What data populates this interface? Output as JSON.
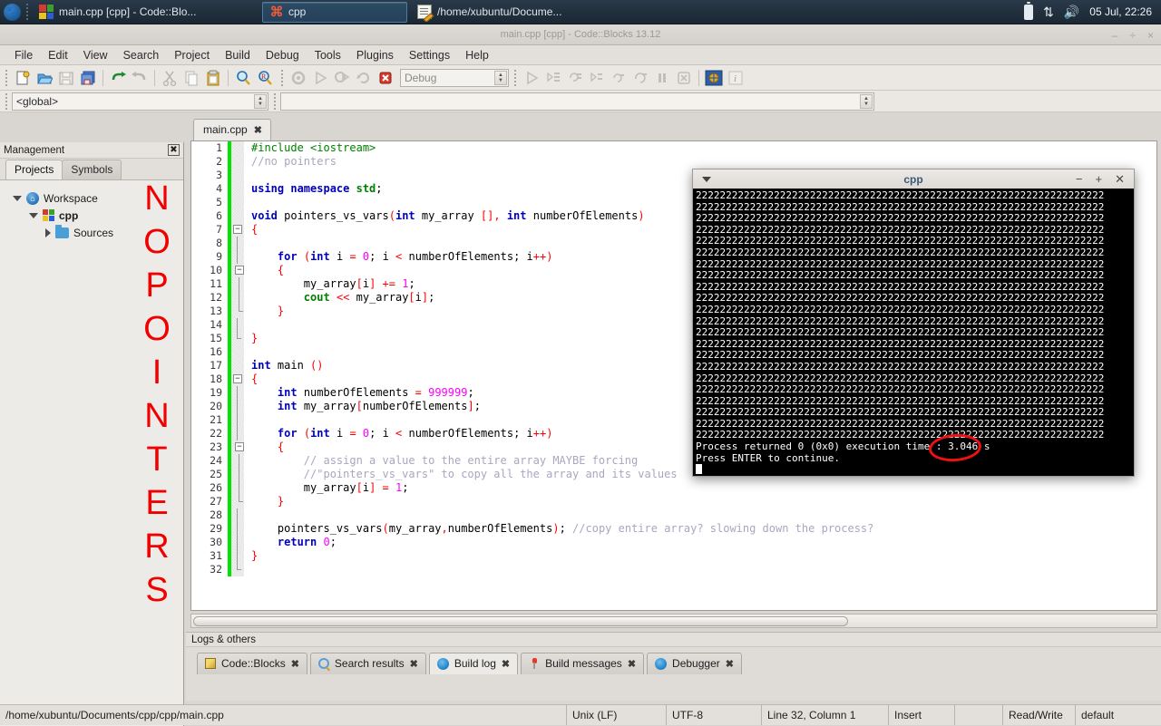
{
  "taskbar": {
    "menu_icon": "xfce-mouse-icon",
    "tasks": [
      {
        "label": "main.cpp [cpp] - Code::Blo...",
        "icon": "codeblocks-icon",
        "active": false
      },
      {
        "label": "cpp",
        "icon": "terminal-icon",
        "active": true
      },
      {
        "label": "/home/xubuntu/Docume...",
        "icon": "text-editor-icon",
        "active": false
      }
    ],
    "tray": {
      "battery": "battery-icon",
      "network": "network-updown-icon",
      "volume": "volume-icon"
    },
    "clock": "05 Jul, 22:26"
  },
  "window": {
    "title": "main.cpp [cpp] - Code::Blocks 13.12",
    "minimize": "–",
    "maximize": "÷",
    "close": "×"
  },
  "menubar": [
    "File",
    "Edit",
    "View",
    "Search",
    "Project",
    "Build",
    "Debug",
    "Tools",
    "Plugins",
    "Settings",
    "Help"
  ],
  "toolbar": {
    "debug_target": "Debug",
    "scope_combo": "<global>",
    "function_combo": ""
  },
  "management": {
    "header": "Management",
    "close_icon": "close-panel-icon",
    "tabs": [
      {
        "label": "Projects",
        "active": true
      },
      {
        "label": "Symbols",
        "active": false
      }
    ],
    "tree": [
      {
        "label": "Workspace",
        "icon": "workspace-icon",
        "expander": "down",
        "indent": 0
      },
      {
        "label": "cpp",
        "icon": "project-icon",
        "expander": "down",
        "indent": 1
      },
      {
        "label": "Sources",
        "icon": "folder-icon",
        "expander": "right",
        "indent": 2
      }
    ]
  },
  "overlay": {
    "text": "NO POINTERS",
    "letters": [
      "N",
      "O",
      "P",
      "O",
      "I",
      "N",
      "T",
      "E",
      "R",
      "S"
    ],
    "color": "#f20000"
  },
  "editor": {
    "tabs": [
      {
        "label": "main.cpp",
        "close": "✖",
        "active": true
      }
    ],
    "first_line": 1,
    "last_line": 32,
    "lines": [
      {
        "n": 1,
        "fold": "none",
        "html": "<span class='pre'>#include &lt;iostream&gt;</span>",
        "text": "#include <iostream>"
      },
      {
        "n": 2,
        "fold": "none",
        "html": "<span class='cmt'>//no pointers</span>",
        "text": "//no pointers"
      },
      {
        "n": 3,
        "fold": "none",
        "html": "",
        "text": ""
      },
      {
        "n": 4,
        "fold": "none",
        "html": "<span class='kw'>using namespace</span> <span class='gn'>std</span>;",
        "text": "using namespace std;"
      },
      {
        "n": 5,
        "fold": "none",
        "html": "",
        "text": ""
      },
      {
        "n": 6,
        "fold": "none",
        "html": "<span class='kw'>void</span> pointers_vs_vars<span class='op'>(</span><span class='kw'>int</span> my_array <span class='op'>[]</span><span class='op'>,</span> <span class='kw'>int</span> numberOfElements<span class='op'>)</span>",
        "text": "void pointers_vs_vars(int my_array [], int numberOfElements)"
      },
      {
        "n": 7,
        "fold": "box",
        "html": "<span class='op'>{</span>",
        "text": "{"
      },
      {
        "n": 8,
        "fold": "line",
        "html": "",
        "text": ""
      },
      {
        "n": 9,
        "fold": "line",
        "html": "    <span class='kw'>for</span> <span class='op'>(</span><span class='kw'>int</span> i <span class='op'>=</span> <span class='num'>0</span>; i <span class='op'>&lt;</span> numberOfElements; i<span class='op'>++</span><span class='op'>)</span>",
        "text": "    for (int i = 0; i < numberOfElements; i++)"
      },
      {
        "n": 10,
        "fold": "box2",
        "html": "    <span class='op'>{</span>",
        "text": "    {"
      },
      {
        "n": 11,
        "fold": "line2",
        "html": "        my_array<span class='op'>[</span>i<span class='op'>]</span> <span class='op'>+=</span> <span class='num'>1</span>;",
        "text": "        my_array[i] += 1;"
      },
      {
        "n": 12,
        "fold": "line2",
        "html": "        <span class='gn'>cout</span> <span class='op'>&lt;&lt;</span> my_array<span class='op'>[</span>i<span class='op'>]</span>;",
        "text": "        cout << my_array[i];"
      },
      {
        "n": 13,
        "fold": "end2",
        "html": "    <span class='op'>}</span>",
        "text": "    }"
      },
      {
        "n": 14,
        "fold": "line",
        "html": "",
        "text": ""
      },
      {
        "n": 15,
        "fold": "end",
        "html": "<span class='op'>}</span>",
        "text": "}"
      },
      {
        "n": 16,
        "fold": "none",
        "html": "",
        "text": ""
      },
      {
        "n": 17,
        "fold": "none",
        "html": "<span class='kw'>int</span> main <span class='op'>()</span>",
        "text": "int main ()"
      },
      {
        "n": 18,
        "fold": "box",
        "html": "<span class='op'>{</span>",
        "text": "{"
      },
      {
        "n": 19,
        "fold": "line",
        "html": "    <span class='kw'>int</span> numberOfElements <span class='op'>=</span> <span class='num'>999999</span>;",
        "text": "    int numberOfElements = 999999;"
      },
      {
        "n": 20,
        "fold": "line",
        "html": "    <span class='kw'>int</span> my_array<span class='op'>[</span>numberOfElements<span class='op'>]</span>;",
        "text": "    int my_array[numberOfElements];"
      },
      {
        "n": 21,
        "fold": "line",
        "html": "",
        "text": ""
      },
      {
        "n": 22,
        "fold": "line",
        "html": "    <span class='kw'>for</span> <span class='op'>(</span><span class='kw'>int</span> i <span class='op'>=</span> <span class='num'>0</span>; i <span class='op'>&lt;</span> numberOfElements; i<span class='op'>++</span><span class='op'>)</span>",
        "text": "    for (int i = 0; i < numberOfElements; i++)"
      },
      {
        "n": 23,
        "fold": "box2",
        "html": "    <span class='op'>{</span>",
        "text": "    {"
      },
      {
        "n": 24,
        "fold": "line2",
        "html": "        <span class='cmt'>// assign a value to the entire array MAYBE forcing</span>",
        "text": "        // assign a value to the entire array MAYBE forcing"
      },
      {
        "n": 25,
        "fold": "line2",
        "html": "        <span class='cmt'>//\"pointers_vs_vars\" to copy all the array and its values</span>",
        "text": "        //\"pointers_vs_vars\" to copy all the array and its values"
      },
      {
        "n": 26,
        "fold": "line2",
        "html": "        my_array<span class='op'>[</span>i<span class='op'>]</span> <span class='op'>=</span> <span class='num'>1</span>;",
        "text": "        my_array[i] = 1;"
      },
      {
        "n": 27,
        "fold": "end2",
        "html": "    <span class='op'>}</span>",
        "text": "    }"
      },
      {
        "n": 28,
        "fold": "line",
        "html": "",
        "text": ""
      },
      {
        "n": 29,
        "fold": "line",
        "html": "    pointers_vs_vars<span class='op'>(</span>my_array<span class='op'>,</span>numberOfElements<span class='op'>)</span>; <span class='cmt'>//copy entire array? slowing down the process?</span>",
        "text": "    pointers_vs_vars(my_array,numberOfElements); //copy entire array? slowing down the process?"
      },
      {
        "n": 30,
        "fold": "line",
        "html": "    <span class='kw'>return</span> <span class='num'>0</span>;",
        "text": "    return 0;"
      },
      {
        "n": 31,
        "fold": "line",
        "html": "<span class='op'>}</span>",
        "text": "}"
      },
      {
        "n": 32,
        "fold": "end",
        "html": "",
        "text": ""
      }
    ]
  },
  "logs": {
    "header": "Logs & others",
    "tabs": [
      {
        "label": "Code::Blocks",
        "icon": "pencil-icon",
        "active": false,
        "close": "✖"
      },
      {
        "label": "Search results",
        "icon": "magnifier-icon",
        "active": false,
        "close": "✖"
      },
      {
        "label": "Build log",
        "icon": "gear-blue-icon",
        "active": true,
        "close": "✖"
      },
      {
        "label": "Build messages",
        "icon": "pin-icon",
        "active": false,
        "close": "✖"
      },
      {
        "label": "Debugger",
        "icon": "gear-blue-icon",
        "active": false,
        "close": "✖"
      }
    ]
  },
  "statusbar": {
    "path": "/home/xubuntu/Documents/cpp/cpp/main.cpp",
    "eol": "Unix (LF)",
    "encoding": "UTF-8",
    "caret": "Line 32, Column 1",
    "mode": "Insert",
    "blank": "",
    "readwrite": "Read/Write",
    "profile": "default"
  },
  "terminal": {
    "title": "cpp",
    "menu_icon": "window-menu-caret-icon",
    "minimize": "−",
    "maximize": "+",
    "close": "✕",
    "fill_char": "2",
    "fill_rows": 22,
    "fill_cols": 68,
    "lines": [
      "Process returned 0 (0x0)   execution time : 3.046 s",
      "Press ENTER to continue."
    ],
    "highlight": {
      "value": "3.046 s",
      "shape": "red-ellipse",
      "color": "#ee1111"
    }
  }
}
